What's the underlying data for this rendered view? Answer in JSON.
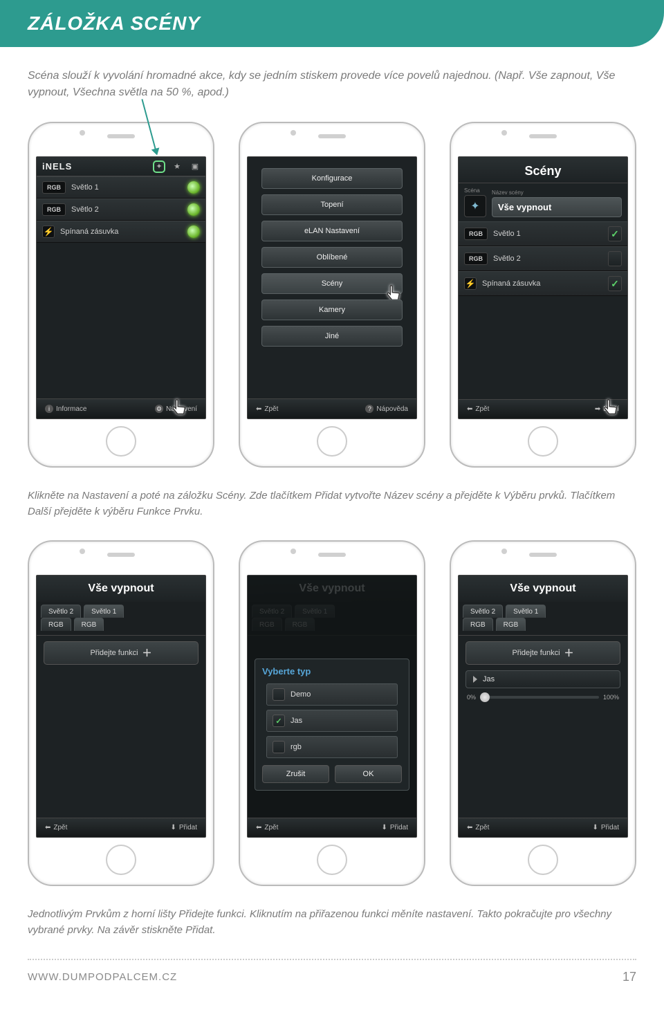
{
  "header": {
    "title": "ZÁLOŽKA SCÉNY"
  },
  "intro": "Scéna slouží k vyvolání hromadné akce, kdy se jedním stiskem provede více povelů najednou. (Např. Vše zapnout, Vše vypnout, Všechna světla na 50 %, apod.)",
  "caption1": "Klikněte na Nastavení a poté na záložku Scény. Zde tlačítkem Přidat vytvořte Název scény a přejděte k Výběru prvků. Tlačítkem Další přejděte k výběru Funkce Prvku.",
  "caption2": "Jednotlivým Prvkům z horní lišty Přidejte funkci. Kliknutím na přiřazenou funkci měníte nastavení. Takto pokračujte pro všechny vybrané prvky. Na závěr stiskněte Přidat.",
  "footer": {
    "url": "WWW.DUMPODPALCEM.CZ",
    "page": "17"
  },
  "phone1": {
    "brand": "iNELS",
    "rows": [
      {
        "chip": "RGB",
        "label": "Světlo 1",
        "kind": "led"
      },
      {
        "chip": "RGB",
        "label": "Světlo 2",
        "kind": "led"
      },
      {
        "chip": "plug",
        "label": "Spínaná zásuvka",
        "kind": "led"
      }
    ],
    "footer": {
      "left": "Informace",
      "right": "Nastavení"
    }
  },
  "phone2": {
    "menu": [
      "Konfigurace",
      "Topení",
      "eLAN Nastavení",
      "Oblíbené",
      "Scény",
      "Kamery",
      "Jiné"
    ],
    "selected": "Scény",
    "footer": {
      "left": "Zpět",
      "right": "Nápověda"
    }
  },
  "phone3": {
    "title": "Scény",
    "scene_col_left": "Scéna",
    "scene_col_right": "Název scény",
    "scene_name": "Vše vypnout",
    "rows": [
      {
        "chip": "RGB",
        "label": "Světlo 1",
        "checked": true
      },
      {
        "chip": "RGB",
        "label": "Světlo 2",
        "checked": false
      },
      {
        "chip": "plug",
        "label": "Spínaná zásuvka",
        "checked": true
      }
    ],
    "footer": {
      "left": "Zpět",
      "right": "Další"
    }
  },
  "phone4": {
    "title": "Vše vypnout",
    "tabs": [
      "Světlo 2",
      "Světlo 1"
    ],
    "subtabs": [
      "RGB",
      "RGB"
    ],
    "add_label": "Přidejte funkci",
    "footer": {
      "left": "Zpět",
      "right": "Přidat"
    }
  },
  "phone5": {
    "title": "Vše vypnout",
    "tabs": [
      "Světlo 2",
      "Světlo 1"
    ],
    "subtabs": [
      "RGB",
      "RGB"
    ],
    "modal": {
      "title": "Vyberte typ",
      "options": [
        {
          "label": "Demo",
          "checked": false
        },
        {
          "label": "Jas",
          "checked": true
        },
        {
          "label": "rgb",
          "checked": false
        }
      ],
      "cancel": "Zrušit",
      "ok": "OK"
    },
    "footer": {
      "left": "Zpět",
      "right": "Přidat"
    }
  },
  "phone6": {
    "title": "Vše vypnout",
    "tabs": [
      "Světlo 2",
      "Světlo 1"
    ],
    "subtabs": [
      "RGB",
      "RGB"
    ],
    "add_label": "Přidejte funkci",
    "func_item": "Jas",
    "slider_min": "0%",
    "slider_max": "100%",
    "footer": {
      "left": "Zpět",
      "right": "Přidat"
    }
  }
}
